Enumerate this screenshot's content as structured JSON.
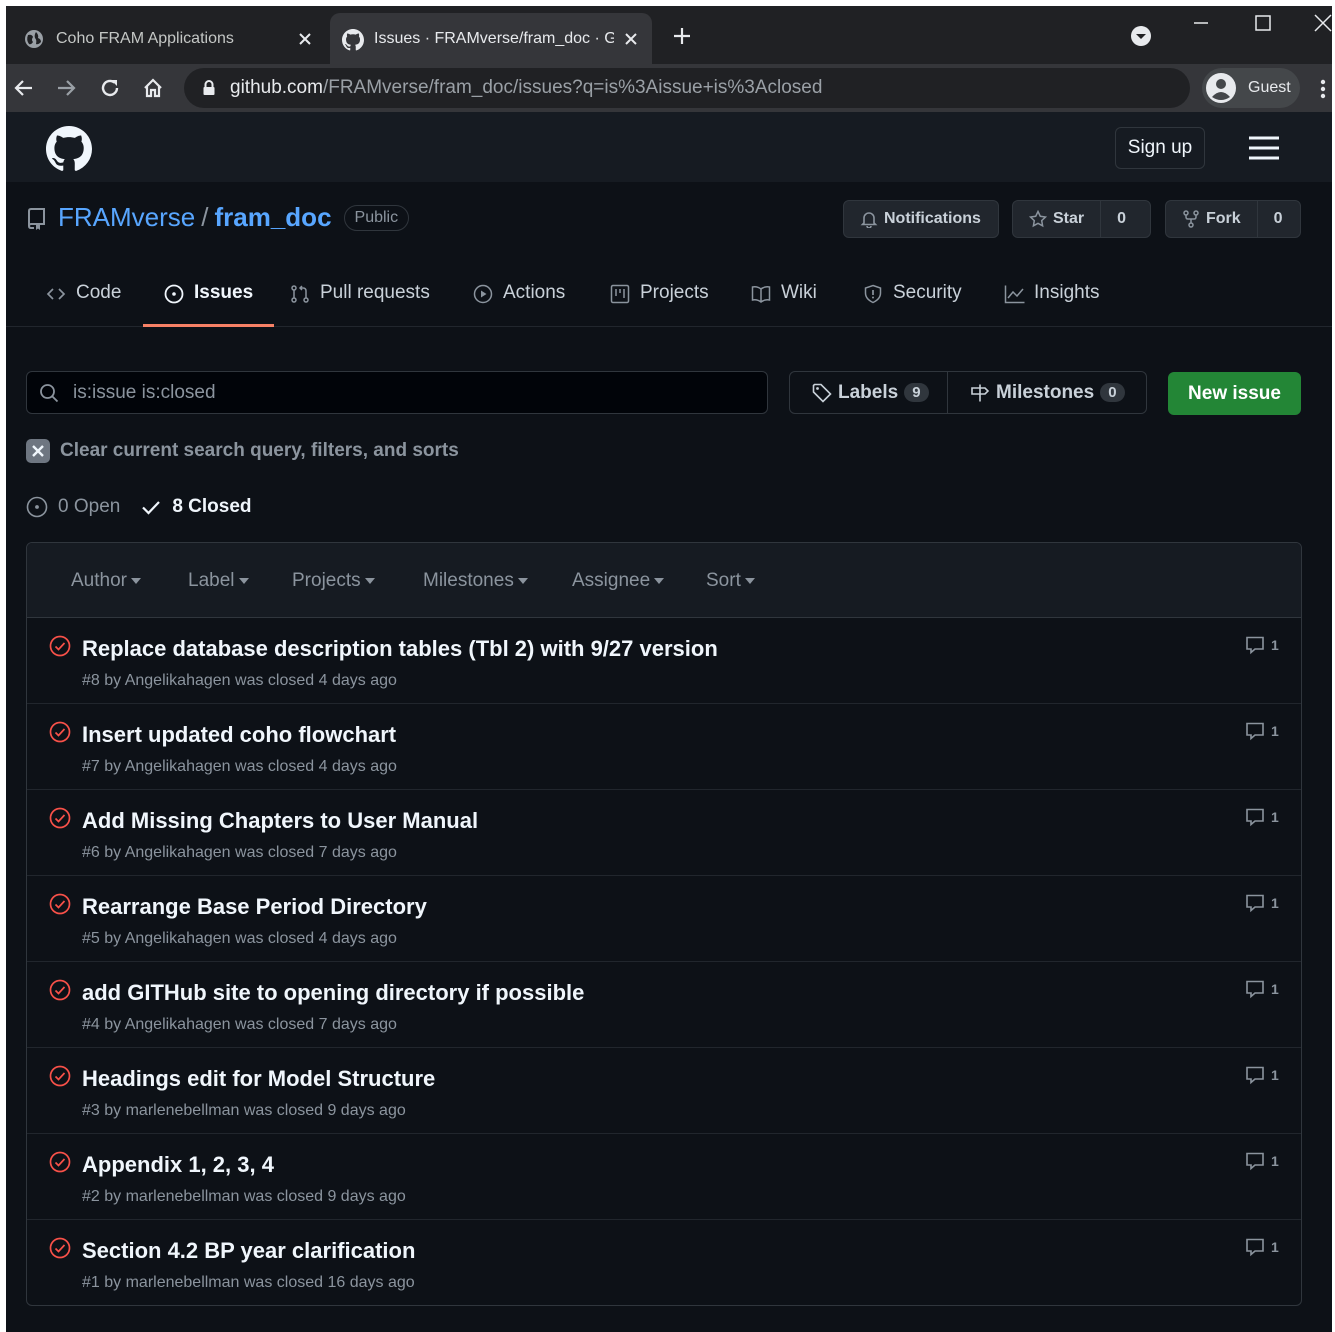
{
  "browser": {
    "tabs": [
      {
        "title": "Coho FRAM Applications"
      },
      {
        "title": "Issues · FRAMverse/fram_doc · GitHub"
      }
    ],
    "url_host": "github.com",
    "url_path": "/FRAMverse/fram_doc/issues?q=is%3Aissue+is%3Aclosed",
    "profile_label": "Guest"
  },
  "header": {
    "signup_label": "Sign up"
  },
  "repo": {
    "owner": "FRAMverse",
    "separator": "/",
    "name": "fram_doc",
    "visibility": "Public",
    "notifications_label": "Notifications",
    "star_label": "Star",
    "star_count": "0",
    "fork_label": "Fork",
    "fork_count": "0"
  },
  "nav": {
    "code": "Code",
    "issues": "Issues",
    "pulls": "Pull requests",
    "actions": "Actions",
    "projects": "Projects",
    "wiki": "Wiki",
    "security": "Security",
    "insights": "Insights"
  },
  "search": {
    "value": "is:issue is:closed",
    "labels_label": "Labels",
    "labels_count": "9",
    "milestones_label": "Milestones",
    "milestones_count": "0",
    "new_issue_label": "New issue",
    "clear_label": "Clear current search query, filters, and sorts"
  },
  "states": {
    "open": "0 Open",
    "closed": "8 Closed"
  },
  "filters": {
    "author": "Author",
    "label": "Label",
    "projects": "Projects",
    "milestones": "Milestones",
    "assignee": "Assignee",
    "sort": "Sort"
  },
  "issues": [
    {
      "title": "Replace database description tables (Tbl 2) with 9/27 version",
      "meta": "#8 by Angelikahagen was closed 4 days ago",
      "comments": "1"
    },
    {
      "title": "Insert updated coho flowchart",
      "meta": "#7 by Angelikahagen was closed 4 days ago",
      "comments": "1"
    },
    {
      "title": "Add Missing Chapters to User Manual",
      "meta": "#6 by Angelikahagen was closed 7 days ago",
      "comments": "1"
    },
    {
      "title": "Rearrange Base Period Directory",
      "meta": "#5 by Angelikahagen was closed 4 days ago",
      "comments": "1"
    },
    {
      "title": "add GITHub site to opening directory if possible",
      "meta": "#4 by Angelikahagen was closed 7 days ago",
      "comments": "1"
    },
    {
      "title": "Headings edit for Model Structure",
      "meta": "#3 by marlenebellman was closed 9 days ago",
      "comments": "1"
    },
    {
      "title": "Appendix 1, 2, 3, 4",
      "meta": "#2 by marlenebellman was closed 9 days ago",
      "comments": "1"
    },
    {
      "title": "Section 4.2 BP year clarification",
      "meta": "#1 by marlenebellman was closed 16 days ago",
      "comments": "1"
    }
  ],
  "colors": {
    "page_bg": "#0d1117",
    "header_bg": "#161b22",
    "link": "#58a6ff",
    "closed_icon": "#f85149",
    "new_issue_bg": "#238636",
    "nav_underline": "#f78166"
  },
  "icons": {
    "tab1": "globe-icon",
    "tab2": "github-icon",
    "repo": "repo-icon",
    "closed": "issue-closed-icon",
    "comment": "comment-icon"
  }
}
